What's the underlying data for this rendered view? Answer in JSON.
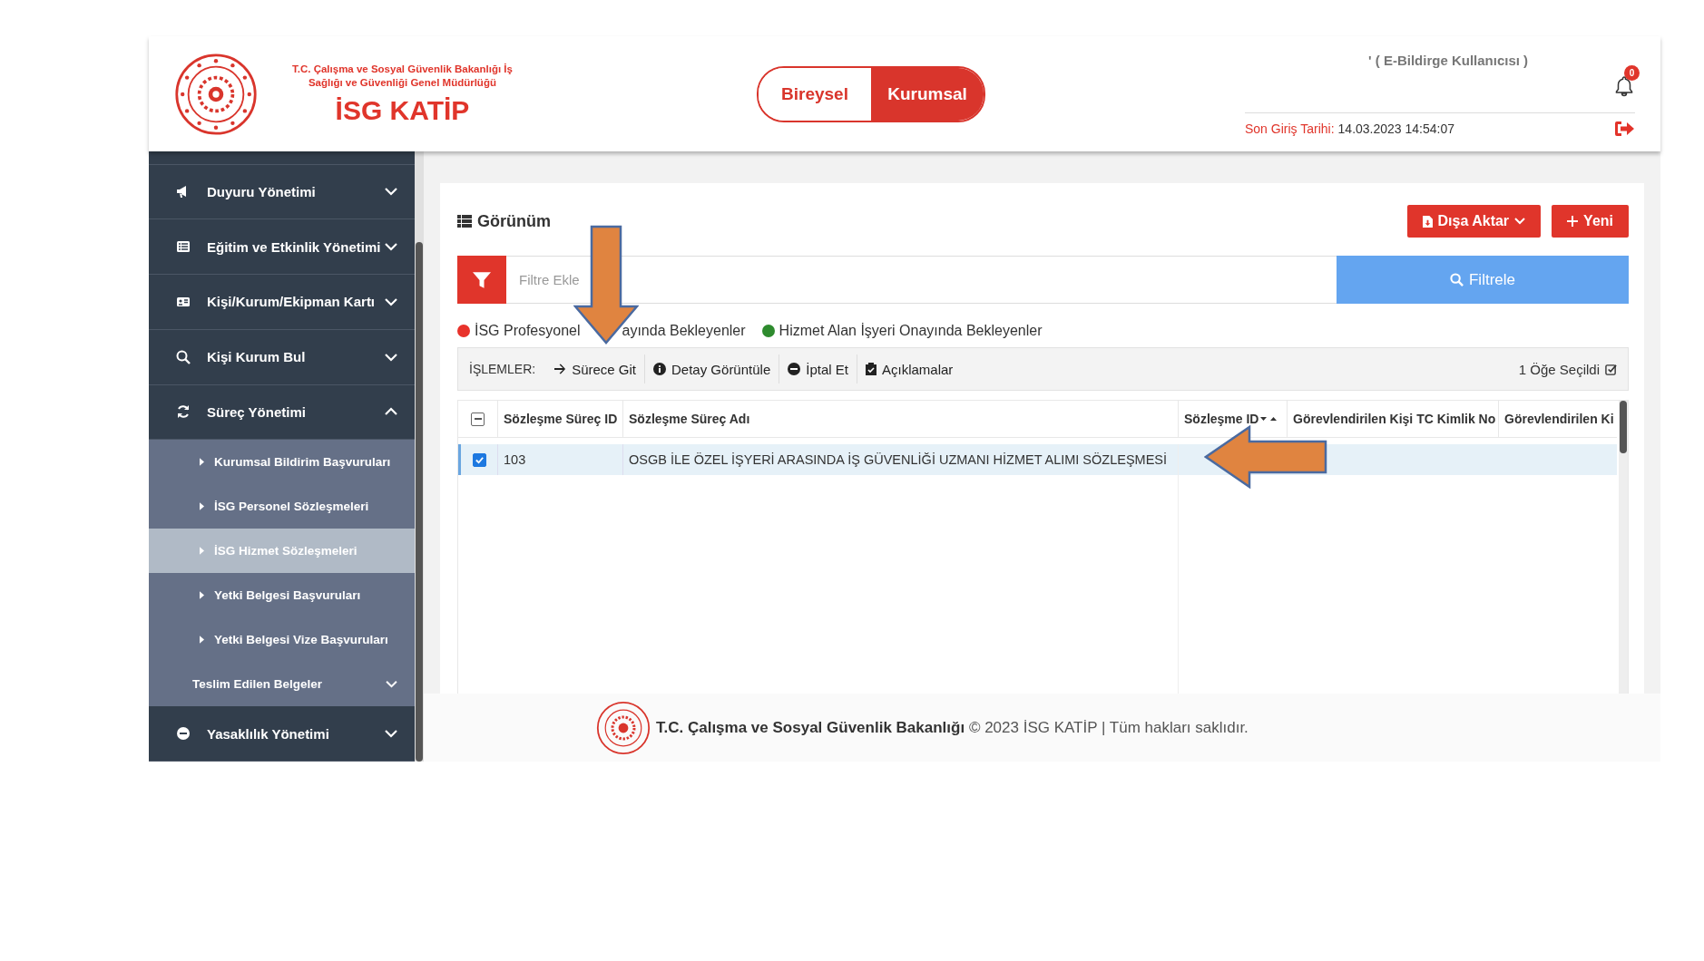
{
  "header": {
    "ministry_lines": [
      "T.C. Çalışma ve Sosyal Güvenlik Bakanlığı İş",
      "Sağlığı ve Güvenliği Genel Müdürlüğü"
    ],
    "app_name": "İSG KATİP",
    "mode_toggle": [
      {
        "label": "Bireysel",
        "selected": false
      },
      {
        "label": "Kurumsal",
        "selected": true
      }
    ],
    "user_role": "' ( E-Bildirge Kullanıcısı )",
    "notification_count": "0",
    "last_login_label": "Son Giriş Tarihi:",
    "last_login_value": "14.03.2023 14:54:07"
  },
  "sidebar": {
    "items": [
      {
        "label": "Duyuru Yönetimi",
        "expanded": false
      },
      {
        "label": "Eğitim ve Etkinlik Yönetimi",
        "expanded": false
      },
      {
        "label": "Kişi/Kurum/Ekipman Kartı",
        "expanded": false
      },
      {
        "label": "Kişi Kurum Bul",
        "expanded": false
      },
      {
        "label": "Süreç Yönetimi",
        "expanded": true,
        "children": [
          {
            "kind": "link",
            "label": "Kurumsal Bildirim Başvuruları",
            "selected": false
          },
          {
            "kind": "link",
            "label": "İSG Personel Sözleşmeleri",
            "selected": false
          },
          {
            "kind": "link",
            "label": "İSG Hizmet Sözleşmeleri",
            "selected": true
          },
          {
            "kind": "link",
            "label": "Yetki Belgesi Başvuruları",
            "selected": false
          },
          {
            "kind": "link",
            "label": "Yetki Belgesi Vize Başvuruları",
            "selected": false
          },
          {
            "kind": "group",
            "label": "Teslim Edilen Belgeler",
            "selected": false
          }
        ]
      },
      {
        "label": "Yasaklılık Yönetimi",
        "expanded": false
      }
    ]
  },
  "main": {
    "title": "Görünüm",
    "export_button": "Dışa Aktar",
    "new_button": "Yeni",
    "filter": {
      "placeholder": "Filtre Ekle",
      "button": "Filtrele"
    },
    "legend": [
      {
        "parts": [
          "İSG Profesyonel",
          "ayında Bekleyenler"
        ],
        "color": "#e8322b"
      },
      {
        "parts": [
          "Hizmet Alan İşyeri Onayında Bekleyenler"
        ],
        "color": "#2e8b2e"
      }
    ],
    "toolbar": {
      "label": "İŞLEMLER:",
      "actions": [
        "Sürece Git",
        "Detay Görüntüle",
        "İptal Et",
        "Açıklamalar"
      ],
      "selection_count": "1 Öğe Seçildi"
    },
    "table": {
      "select_all_indeterminate": true,
      "columns": [
        {
          "label": "Sözleşme Süreç ID",
          "kind": "plain"
        },
        {
          "label": "Sözleşme Süreç Adı",
          "kind": "plain"
        },
        {
          "label": "Sözleşme ID",
          "kind": "sorted"
        },
        {
          "label": "Görevlendirilen Kişi TC Kimlik No",
          "kind": "plain"
        },
        {
          "label": "Görevlendirilen Ki",
          "kind": "plain"
        }
      ],
      "rows": [
        {
          "selected": true,
          "cells": [
            "103",
            "OSGB İLE ÖZEL İŞYERİ ARASINDA İŞ GÜVENLİĞİ UZMANI HİZMET ALIMI SÖZLEŞMESİ"
          ]
        }
      ]
    }
  },
  "footer": {
    "text": "**T.C. Çalışma ve Sosyal Güvenlik Bakanlığı** © 2023 İSG KATİP | Tüm hakları saklıdır."
  }
}
